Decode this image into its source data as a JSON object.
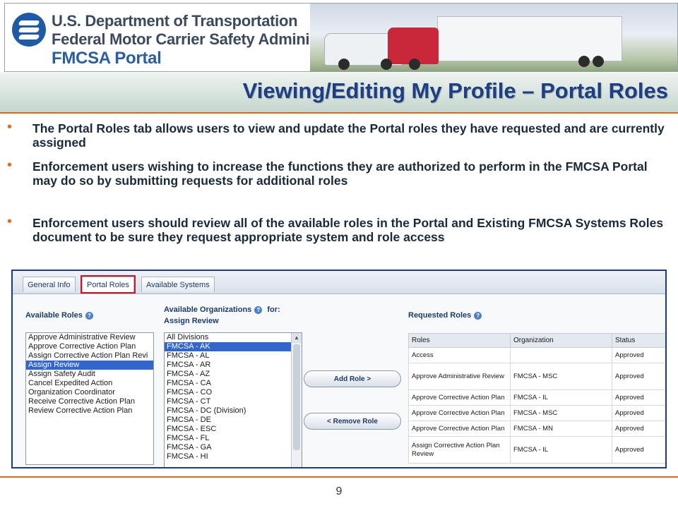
{
  "banner": {
    "org_line1": "U.S. Department of Transportation",
    "org_line2": "Federal Motor Carrier Safety Administration",
    "portal_name": "FMCSA Portal"
  },
  "title": "Viewing/Editing My Profile – Portal Roles",
  "bullets": [
    "The Portal Roles tab allows users to view and update the Portal roles they have requested and are currently assigned",
    "Enforcement users wishing to increase the functions they are authorized to perform in the FMCSA Portal may do so by submitting requests for additional roles",
    "Enforcement users should review all of the available roles in the Portal and Existing FMCSA Systems Roles document to be sure they request appropriate system and role access"
  ],
  "screenshot": {
    "tabs": [
      {
        "label": "General Info",
        "active": false
      },
      {
        "label": "Portal Roles",
        "active": true
      },
      {
        "label": "Available Systems",
        "active": false
      }
    ],
    "available_roles_label": "Available Roles",
    "available_orgs_label": "Available Organizations",
    "for_label": "for:",
    "assign_target": "Assign Review",
    "requested_roles_label": "Requested Roles",
    "available_roles": [
      "Approve Administrative Review",
      "Approve Corrective Action Plan",
      "Assign Corrective Action Plan Revi",
      "Assign Review",
      "Assign Safety Audit",
      "Cancel Expedited Action",
      "Organization Coordinator",
      "Receive Corrective Action Plan",
      "Review Corrective Action Plan"
    ],
    "selected_role_index": 3,
    "organizations": [
      "All Divisions",
      "FMCSA - AK",
      "FMCSA - AL",
      "FMCSA - AR",
      "FMCSA - AZ",
      "FMCSA - CA",
      "FMCSA - CO",
      "FMCSA - CT",
      "FMCSA - DC (Division)",
      "FMCSA - DE",
      "FMCSA - ESC",
      "FMCSA - FL",
      "FMCSA - GA",
      "FMCSA - HI"
    ],
    "selected_org_index": 1,
    "add_role_label": "Add Role >",
    "remove_role_label": "< Remove Role",
    "table_headers": [
      "Roles",
      "Organization",
      "Status"
    ],
    "table_rows": [
      [
        "Access",
        "",
        "Approved"
      ],
      [
        "Approve Administrative Review",
        "FMCSA - MSC",
        "Approved"
      ],
      [
        "Approve Corrective Action Plan",
        "FMCSA - IL",
        "Approved"
      ],
      [
        "Approve Corrective Action Plan",
        "FMCSA - MSC",
        "Approved"
      ],
      [
        "Approve Corrective Action Plan",
        "FMCSA - MN",
        "Approved"
      ],
      [
        "Assign Corrective Action Plan Review",
        "FMCSA - IL",
        "Approved"
      ]
    ]
  },
  "page_number": "9",
  "colors": {
    "title": "#1f3e86",
    "accent_orange": "#d2691e",
    "highlight_red": "#c21a2a",
    "selection_blue": "#3366cc"
  }
}
